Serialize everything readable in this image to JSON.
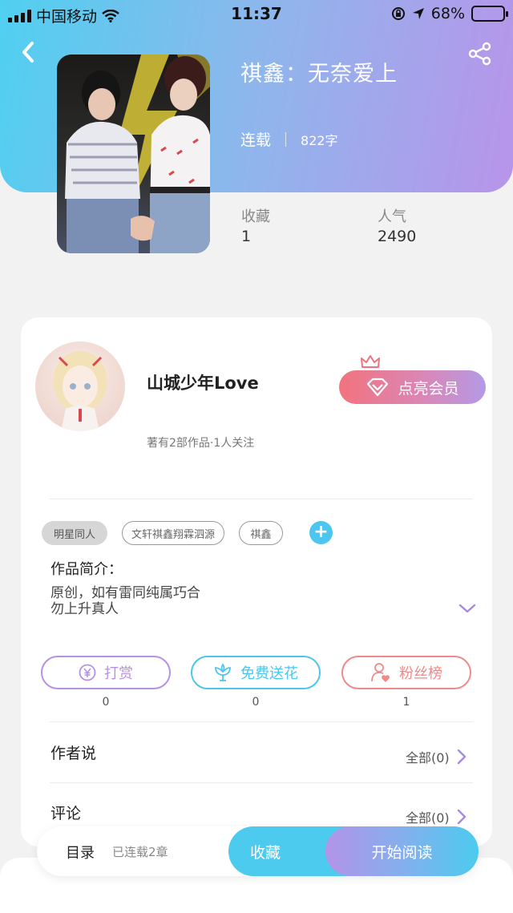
{
  "status_bar": {
    "carrier": "中国移动",
    "time": "11:37",
    "battery": "68%",
    "battery_level": 0.68
  },
  "book": {
    "title": "祺鑫：无奈爱上",
    "status": "连载",
    "word_count": "822字"
  },
  "stats": {
    "favorites_label": "收藏",
    "favorites_value": "1",
    "popularity_label": "人气",
    "popularity_value": "2490"
  },
  "author": {
    "name": "山城少年Love",
    "meta": "著有2部作品·1人关注",
    "vip_button": "点亮会员"
  },
  "tags": [
    "明星同人",
    "文轩祺鑫翔霖泗源",
    "祺鑫"
  ],
  "intro": {
    "label": "作品简介：",
    "line1": "原创，如有雷同纯属巧合",
    "line2": "勿上升真人"
  },
  "actions": [
    {
      "label": "打赏",
      "count": "0",
      "color": "#b592e4"
    },
    {
      "label": "免费送花",
      "count": "0",
      "color": "#4cc6ee"
    },
    {
      "label": "粉丝榜",
      "count": "1",
      "color": "#ee8a8a"
    }
  ],
  "sections": {
    "author_says": {
      "title": "作者说",
      "link": "全部(0)"
    },
    "comments": {
      "title": "评论",
      "link": "全部(0)"
    }
  },
  "bottom_bar": {
    "toc": "目录",
    "serial": "已连载2章",
    "favorite": "收藏",
    "read": "开始阅读"
  }
}
